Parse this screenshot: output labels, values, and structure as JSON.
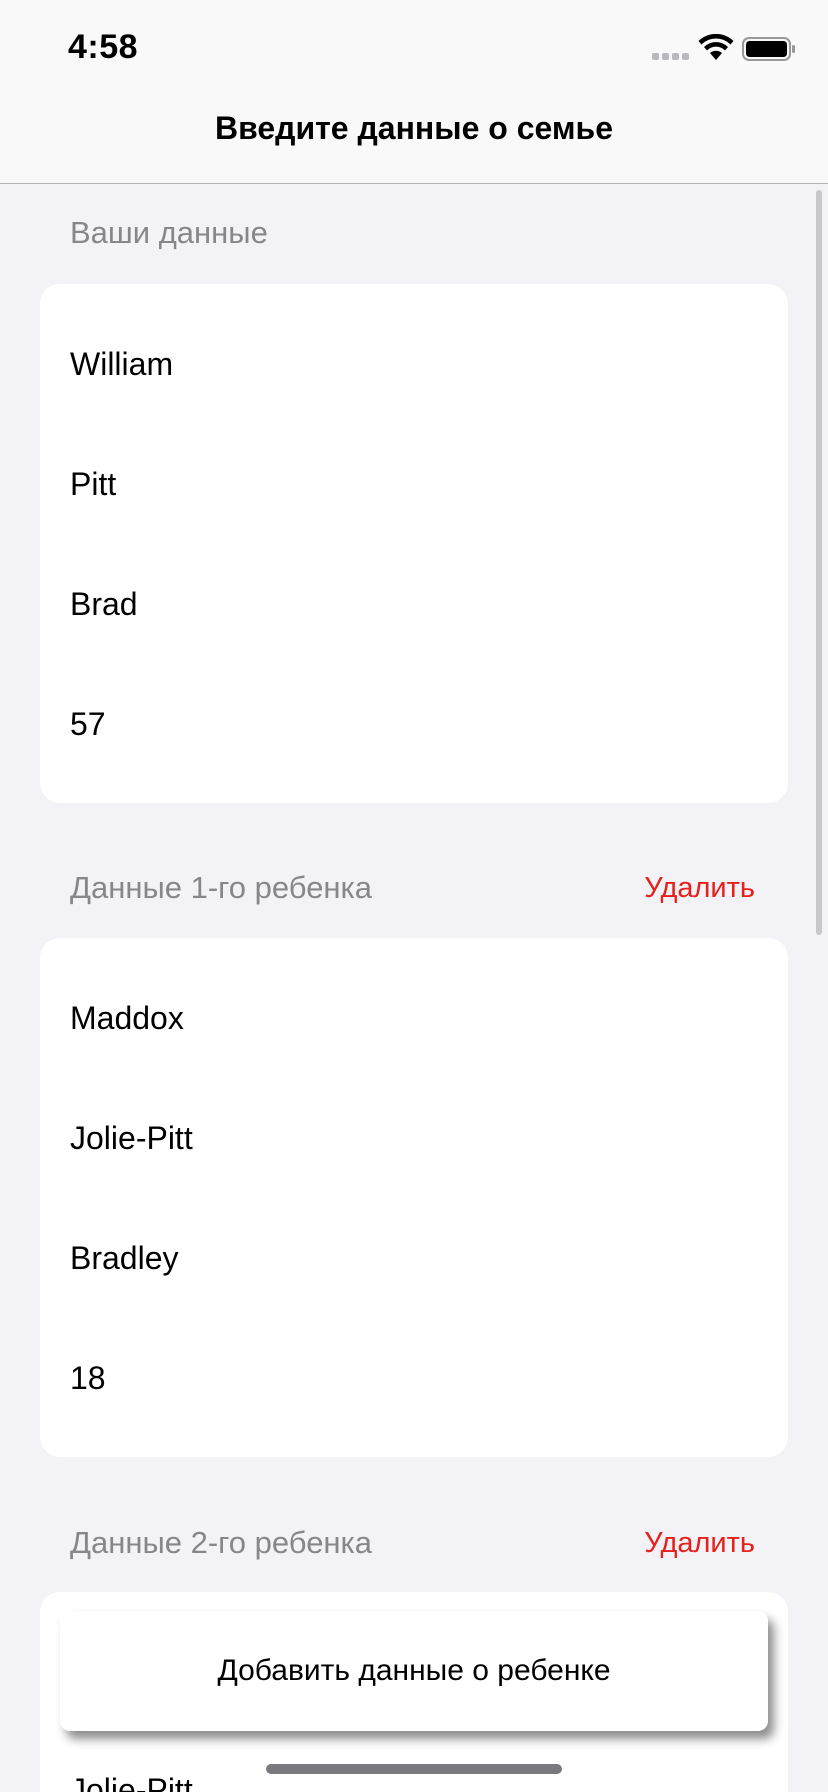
{
  "status_bar": {
    "time": "4:58"
  },
  "nav": {
    "title": "Введите данные о семье"
  },
  "sections": [
    {
      "header": "Ваши данные",
      "delete_label": "",
      "fields": [
        "William",
        "Pitt",
        "Brad",
        "57"
      ]
    },
    {
      "header": "Данные 1-го ребенка",
      "delete_label": "Удалить",
      "fields": [
        "Maddox",
        "Jolie-Pitt",
        "Bradley",
        "18"
      ]
    },
    {
      "header": "Данные 2-го ребенка",
      "delete_label": "Удалить",
      "fields": [
        "",
        "Jolie-Pitt"
      ]
    }
  ],
  "add_button_label": "Добавить данные о ребенке",
  "colors": {
    "accent_destructive": "#e6211b",
    "background": "#f2f2f7",
    "header_text": "#86868b"
  }
}
